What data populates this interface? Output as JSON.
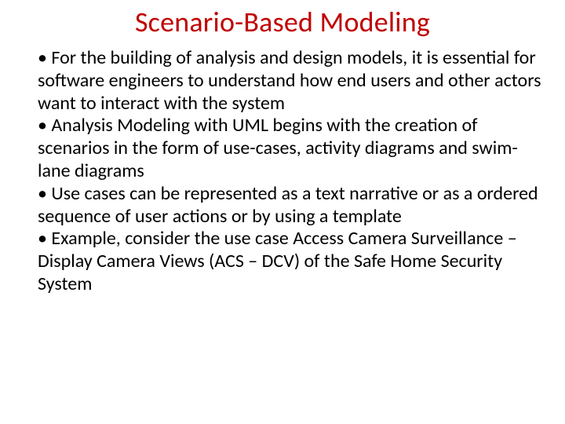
{
  "title": "Scenario-Based Modeling",
  "bullets": [
    {
      "marker": "• ",
      "text": "For the building of analysis and design models, it is essential for software engineers to understand how end users and other actors want to interact with the system"
    },
    {
      "marker": "• ",
      "text": "Analysis Modeling with UML begins with the creation of scenarios in the form of use-cases, activity diagrams and swim-lane diagrams"
    },
    {
      "marker": "• ",
      "text": "Use cases can be represented as  a text narrative or as a ordered sequence of user actions or by using a template"
    },
    {
      "marker": "• ",
      "text": "Example, consider the use case Access Camera Surveillance – Display Camera Views (ACS – DCV) of the Safe Home Security System"
    }
  ]
}
